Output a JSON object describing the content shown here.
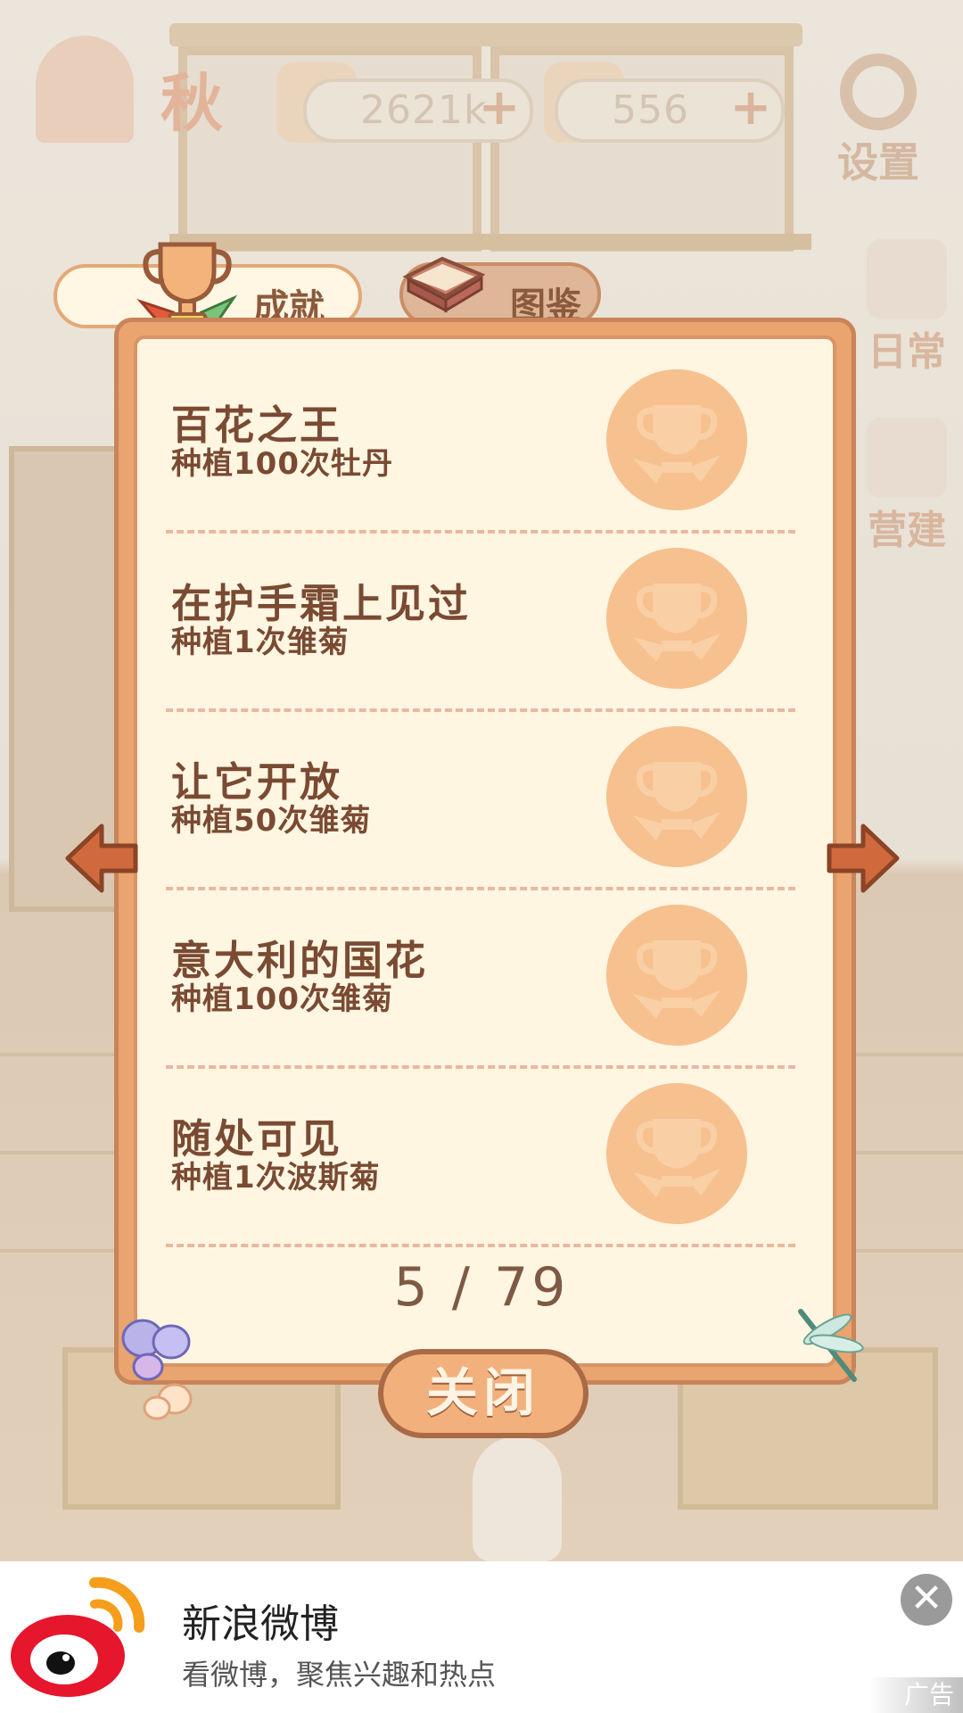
{
  "hud": {
    "season": "秋",
    "fish_value": "2621k",
    "cheese_value": "556",
    "plus_symbol": "+",
    "settings_label": "设置",
    "side_daily_label": "日常",
    "side_build_label": "营建"
  },
  "tabs": {
    "achievements": "成就",
    "collection": "图鉴"
  },
  "achievements": [
    {
      "title": "百花之王",
      "desc": "种植100次牡丹"
    },
    {
      "title": "在护手霜上见过",
      "desc": "种植1次雏菊"
    },
    {
      "title": "让它开放",
      "desc": "种植50次雏菊"
    },
    {
      "title": "意大利的国花",
      "desc": "种植100次雏菊"
    },
    {
      "title": "随处可见",
      "desc": "种植1次波斯菊"
    }
  ],
  "pagination": {
    "label": "5 / 79"
  },
  "close_label": "关闭",
  "ad": {
    "title": "新浪微博",
    "subtitle": "看微博，聚焦兴趣和热点",
    "tag": "广告",
    "close_glyph": "✕"
  },
  "colors": {
    "panel_orange": "#e9a46f",
    "panel_cream": "#fff6e2",
    "text_brown": "#7a4a32",
    "medal_peach": "#f7c08f",
    "weibo_red": "#e6162d",
    "weibo_orange": "#f59e1b"
  }
}
